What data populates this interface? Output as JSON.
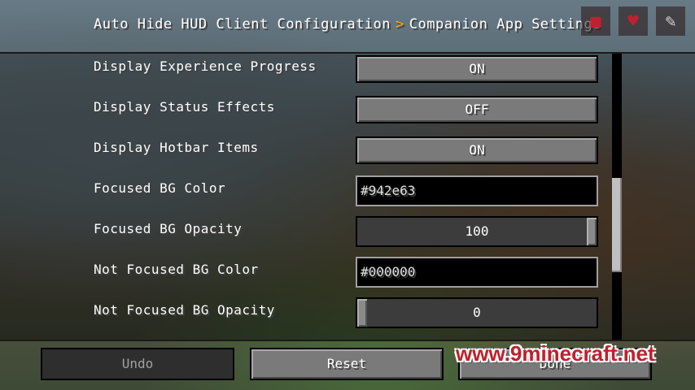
{
  "header": {
    "breadcrumb_root": "Auto Hide HUD Client Configuration",
    "separator": ">",
    "breadcrumb_current": "Companion App Settings",
    "icons": [
      "unknown-red-icon",
      "heart-icon",
      "pen-icon"
    ]
  },
  "settings": [
    {
      "label": "Display Experience Progress",
      "type": "toggle",
      "value": "ON"
    },
    {
      "label": "Display Status Effects",
      "type": "toggle",
      "value": "OFF"
    },
    {
      "label": "Display Hotbar Items",
      "type": "toggle",
      "value": "ON"
    },
    {
      "label": "Focused BG Color",
      "type": "text",
      "value": "#942e63"
    },
    {
      "label": "Focused BG Opacity",
      "type": "slider",
      "value": "100",
      "fraction": 1.0
    },
    {
      "label": "Not Focused BG Color",
      "type": "text",
      "value": "#000000"
    },
    {
      "label": "Not Focused BG Opacity",
      "type": "slider",
      "value": "0",
      "fraction": 0.0
    }
  ],
  "scrollbar": {
    "position_fraction": 0.65
  },
  "footer": {
    "undo_label": "Undo",
    "reset_label": "Reset",
    "done_label": "Done"
  },
  "watermark": "www.9minecraft.net",
  "colors": {
    "accent_separator": "#ffaa00",
    "watermark": "#c0202a"
  }
}
